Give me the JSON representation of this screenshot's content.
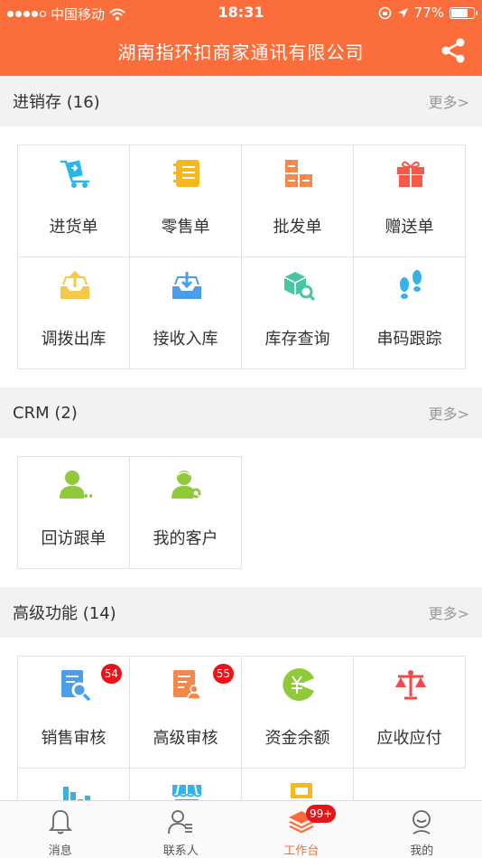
{
  "status_bar": {
    "carrier": "中国移动",
    "time": "18:31",
    "battery_percent": "77%",
    "battery_level": 0.77
  },
  "nav": {
    "title": "湖南指环扣商家通讯有限公司",
    "share_icon": "share-icon"
  },
  "sections": [
    {
      "title": "进销存 (16)",
      "more": "更多>",
      "items": [
        {
          "label": "进货单",
          "icon": "cart-icon",
          "color": "#29b7e8"
        },
        {
          "label": "零售单",
          "icon": "notebook-icon",
          "color": "#f6b81c"
        },
        {
          "label": "批发单",
          "icon": "blocks-icon",
          "color": "#f4874b"
        },
        {
          "label": "赠送单",
          "icon": "gift-icon",
          "color": "#f4594c"
        },
        {
          "label": "调拨出库",
          "icon": "tray-out-icon",
          "color": "#f6c84a"
        },
        {
          "label": "接收入库",
          "icon": "tray-in-icon",
          "color": "#4c9ee8"
        },
        {
          "label": "库存查询",
          "icon": "box-search-icon",
          "color": "#48c5a3"
        },
        {
          "label": "串码跟踪",
          "icon": "footprints-icon",
          "color": "#36b2e6"
        }
      ]
    },
    {
      "title": "CRM (2)",
      "more": "更多>",
      "items": [
        {
          "label": "回访跟单",
          "icon": "person-dots-icon",
          "color": "#8fca3a"
        },
        {
          "label": "我的客户",
          "icon": "person-search-icon",
          "color": "#8fca3a"
        }
      ]
    },
    {
      "title": "高级功能 (14)",
      "more": "更多>",
      "items": [
        {
          "label": "销售审核",
          "icon": "doc-search-icon",
          "color": "#4c9ee8",
          "badge": "54"
        },
        {
          "label": "高级审核",
          "icon": "doc-user-icon",
          "color": "#f4874b",
          "badge": "55"
        },
        {
          "label": "资金余额",
          "icon": "yen-pie-icon",
          "color": "#8fca3a"
        },
        {
          "label": "应收应付",
          "icon": "scale-icon",
          "color": "#f04a4a"
        },
        {
          "label": "",
          "icon": "bar-chart-icon",
          "color": "#36b2e6"
        },
        {
          "label": "",
          "icon": "store-icon",
          "color": "#36b2e6"
        },
        {
          "label": "",
          "icon": "shelf-icon",
          "color": "#f6b81c"
        }
      ]
    }
  ],
  "tabs": [
    {
      "label": "消息",
      "icon": "bell-icon"
    },
    {
      "label": "联系人",
      "icon": "contacts-icon"
    },
    {
      "label": "工作台",
      "icon": "layers-icon",
      "badge": "99+",
      "active": true
    },
    {
      "label": "我的",
      "icon": "profile-icon"
    }
  ],
  "colors": {
    "brand": "#fb6e3b",
    "badge": "#e8141a",
    "section_bg": "#f2f2f2"
  }
}
